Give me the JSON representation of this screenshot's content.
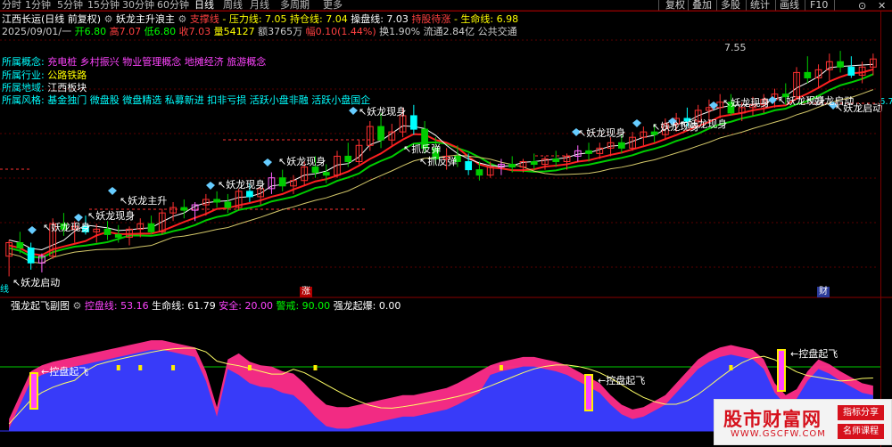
{
  "toolbar": {
    "periods": [
      "分时",
      "1分钟",
      "5分钟",
      "15分钟",
      "30分钟",
      "60分钟",
      "日线",
      "周线",
      "月线",
      "多周期",
      "更多"
    ],
    "active_period": "日线",
    "buttons": [
      "复权",
      "叠加",
      "多股",
      "统计",
      "画线",
      "F10"
    ],
    "close_glyph": "✕"
  },
  "header": {
    "stock": "江西长运(日线 前复权)",
    "indicator_name": "妖龙主升浪主",
    "support_label": "支撑线",
    "pressure": "压力线: 7.05",
    "position": "持仓线: 7.04",
    "operate": "操盘线: 7.03",
    "hold": "持股待涨",
    "life": "生命线: 6.98",
    "date": "2025/09/01/一",
    "open": "开6.80",
    "high": "高7.07",
    "low": "低6.80",
    "close": "收7.03",
    "volume": "量54127",
    "amount": "额3765万",
    "change": "幅0.10(1.44%)",
    "turnover": "换1.90%",
    "float_cap": "流通2.84亿",
    "industry_short": "公共交通"
  },
  "concepts": [
    {
      "label": "所属概念:",
      "value": "充电桩 乡村振兴 物业管理概念 地摊经济 旅游概念",
      "color": "#ff44ff"
    },
    {
      "label": "所属行业:",
      "value": "公路铁路",
      "color": "#ffff00"
    },
    {
      "label": "所属地域:",
      "value": "江西板块",
      "color": "#ffffff"
    },
    {
      "label": "所属风格:",
      "value": "基金独门 微盘股 微盘精选 私募新进 扣非亏损 活跃小盘非融 活跃小盘国企",
      "color": "#00ffff"
    }
  ],
  "annotations": {
    "peak_price": "7.55",
    "axis_value": "6.7",
    "zhang": "涨",
    "cai": "财",
    "edge_left": "线",
    "yaolong_xianshen": "妖龙现身",
    "yaolong_zhusheng": "妖龙主升",
    "yaolong_qidong": "妖龙启动",
    "yaolong_kaishi": "妖龙启动",
    "zhuafantan": "抓反弹",
    "faw_duo": "妖龙现身"
  },
  "sub": {
    "title": "强龙起飞副图",
    "kongpan": "控盘线: 53.16",
    "shengming": "生命线: 61.79",
    "anquan": "安全: 20.00",
    "jingjie": "警戒: 90.00",
    "qifei": "强龙起爆: 0.00",
    "tag": "控盘起飞"
  },
  "watermark": {
    "title": "股市财富网",
    "url": "WWW.GSCFW.COM",
    "tag1": "指标分享",
    "tag2": "名师课程"
  },
  "chart_data": {
    "type": "candlestick",
    "candles": [
      [
        6.6,
        6.72,
        6.45,
        6.7
      ],
      [
        6.7,
        6.78,
        6.62,
        6.66
      ],
      [
        6.66,
        6.7,
        6.5,
        6.55
      ],
      [
        6.55,
        6.62,
        6.48,
        6.6
      ],
      [
        6.6,
        6.88,
        6.58,
        6.84
      ],
      [
        6.84,
        6.92,
        6.75,
        6.8
      ],
      [
        6.8,
        6.86,
        6.7,
        6.82
      ],
      [
        6.82,
        6.9,
        6.76,
        6.78
      ],
      [
        6.78,
        6.84,
        6.7,
        6.8
      ],
      [
        6.8,
        6.86,
        6.72,
        6.76
      ],
      [
        6.76,
        6.83,
        6.7,
        6.74
      ],
      [
        6.74,
        6.82,
        6.68,
        6.8
      ],
      [
        6.8,
        6.88,
        6.74,
        6.84
      ],
      [
        6.84,
        6.9,
        6.76,
        6.78
      ],
      [
        6.78,
        6.95,
        6.76,
        6.92
      ],
      [
        6.92,
        7.0,
        6.86,
        6.96
      ],
      [
        6.96,
        7.02,
        6.88,
        6.94
      ],
      [
        6.94,
        7.0,
        6.86,
        6.98
      ],
      [
        6.98,
        7.06,
        6.9,
        7.02
      ],
      [
        7.02,
        7.08,
        6.96,
        7.0
      ],
      [
        7.0,
        7.06,
        6.92,
        6.96
      ],
      [
        6.96,
        7.1,
        6.94,
        7.08
      ],
      [
        7.08,
        7.14,
        7.0,
        7.04
      ],
      [
        7.04,
        7.12,
        6.98,
        7.1
      ],
      [
        7.1,
        7.22,
        7.06,
        7.18
      ],
      [
        7.18,
        7.24,
        7.08,
        7.12
      ],
      [
        7.12,
        7.2,
        7.06,
        7.16
      ],
      [
        7.16,
        7.3,
        7.12,
        7.26
      ],
      [
        7.26,
        7.34,
        7.18,
        7.22
      ],
      [
        7.22,
        7.28,
        7.14,
        7.2
      ],
      [
        7.2,
        7.38,
        7.18,
        7.34
      ],
      [
        7.34,
        7.44,
        7.26,
        7.3
      ],
      [
        7.3,
        7.46,
        7.28,
        7.42
      ],
      [
        7.42,
        7.6,
        7.38,
        7.56
      ],
      [
        7.56,
        7.66,
        7.4,
        7.46
      ],
      [
        7.46,
        7.58,
        7.42,
        7.52
      ],
      [
        7.52,
        7.7,
        7.48,
        7.64
      ],
      [
        7.64,
        7.72,
        7.5,
        7.54
      ],
      [
        7.54,
        7.6,
        7.36,
        7.4
      ],
      [
        7.4,
        7.48,
        7.28,
        7.32
      ],
      [
        7.32,
        7.4,
        7.24,
        7.34
      ],
      [
        7.34,
        7.42,
        7.26,
        7.3
      ],
      [
        7.3,
        7.36,
        7.2,
        7.24
      ],
      [
        7.24,
        7.3,
        7.16,
        7.2
      ],
      [
        7.2,
        7.3,
        7.18,
        7.26
      ],
      [
        7.26,
        7.32,
        7.2,
        7.28
      ],
      [
        7.28,
        7.34,
        7.22,
        7.26
      ],
      [
        7.26,
        7.32,
        7.22,
        7.3
      ],
      [
        7.3,
        7.36,
        7.24,
        7.28
      ],
      [
        7.28,
        7.34,
        7.24,
        7.32
      ],
      [
        7.32,
        7.38,
        7.26,
        7.3
      ],
      [
        7.3,
        7.36,
        7.24,
        7.34
      ],
      [
        7.34,
        7.42,
        7.3,
        7.38
      ],
      [
        7.38,
        7.44,
        7.3,
        7.36
      ],
      [
        7.36,
        7.44,
        7.32,
        7.4
      ],
      [
        7.4,
        7.48,
        7.34,
        7.44
      ],
      [
        7.44,
        7.5,
        7.36,
        7.4
      ],
      [
        7.4,
        7.52,
        7.38,
        7.48
      ],
      [
        7.48,
        7.56,
        7.42,
        7.52
      ],
      [
        7.52,
        7.58,
        7.44,
        7.5
      ],
      [
        7.5,
        7.62,
        7.46,
        7.58
      ],
      [
        7.58,
        7.66,
        7.52,
        7.62
      ],
      [
        7.62,
        7.7,
        7.56,
        7.6
      ],
      [
        7.6,
        7.72,
        7.58,
        7.68
      ],
      [
        7.68,
        7.76,
        7.6,
        7.7
      ],
      [
        7.7,
        7.8,
        7.62,
        7.74
      ],
      [
        7.74,
        7.8,
        7.64,
        7.66
      ],
      [
        7.66,
        7.74,
        7.6,
        7.7
      ],
      [
        7.7,
        7.78,
        7.64,
        7.72
      ],
      [
        7.72,
        7.8,
        7.66,
        7.76
      ],
      [
        7.76,
        7.84,
        7.7,
        7.8
      ],
      [
        7.8,
        7.88,
        7.72,
        7.78
      ],
      [
        7.78,
        8.0,
        7.76,
        7.96
      ],
      [
        7.96,
        8.08,
        7.88,
        7.92
      ],
      [
        7.92,
        8.02,
        7.84,
        7.98
      ],
      [
        7.98,
        8.1,
        7.9,
        8.04
      ],
      [
        8.04,
        8.12,
        7.96,
        8.0
      ],
      [
        8.0,
        8.08,
        7.92,
        7.94
      ],
      [
        7.94,
        8.04,
        7.88,
        8.0
      ],
      [
        8.0,
        8.1,
        7.94,
        8.06
      ]
    ],
    "subchart": {
      "series": [
        {
          "name": "控盘线",
          "color": "#ff2d8a"
        },
        {
          "name": "生命线",
          "color": "#ffff66"
        }
      ],
      "ylim": [
        0,
        100
      ]
    }
  }
}
